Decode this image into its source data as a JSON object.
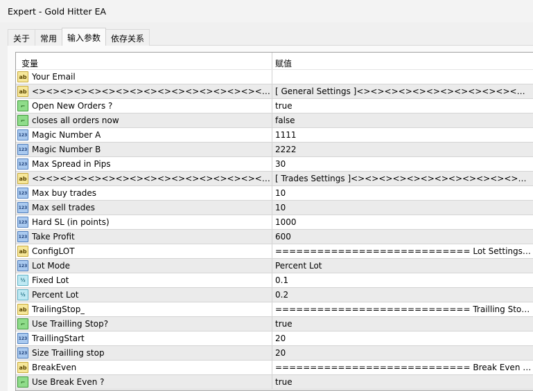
{
  "window": {
    "title": "Expert - Gold Hitter EA"
  },
  "tabs": [
    {
      "label": "关于"
    },
    {
      "label": "常用"
    },
    {
      "label": "输入参数",
      "active": true
    },
    {
      "label": "依存关系"
    }
  ],
  "table": {
    "headers": {
      "variable": "变量",
      "value": "赋值"
    },
    "rows": [
      {
        "type": "ab",
        "name": "Your Email",
        "value": ""
      },
      {
        "type": "ab",
        "name": "<><><><><><><><><><><><><><><><><><><><><><><><><><><><><><><>",
        "value": "[ General Settings ]<><><><><><><><><><><><><><><><><><><><><><><><>"
      },
      {
        "type": "bool",
        "name": "Open New Orders ?",
        "value": "true"
      },
      {
        "type": "bool",
        "name": "closes all orders now",
        "value": "false"
      },
      {
        "type": "int",
        "name": "Magic Number  A",
        "value": "1111"
      },
      {
        "type": "int",
        "name": "Magic Number  B",
        "value": "2222"
      },
      {
        "type": "int",
        "name": "Max Spread in Pips",
        "value": "30"
      },
      {
        "type": "ab",
        "name": "<><><><><><><><><><><><><><><><><><><><><><><><><><><><><><><>",
        "value": "[ Trades Settings ]<><><><><><><><><><><><><><><><><><><><><><><><>"
      },
      {
        "type": "int",
        "name": "Max buy trades",
        "value": "10"
      },
      {
        "type": "int",
        "name": "Max sell trades",
        "value": "10"
      },
      {
        "type": "int",
        "name": "Hard SL (in points)",
        "value": "1000"
      },
      {
        "type": "int",
        "name": "Take Profit",
        "value": "600"
      },
      {
        "type": "ab",
        "name": "ConfigLOT",
        "value": "============================ Lot Settings ============"
      },
      {
        "type": "int",
        "name": "Lot Mode",
        "value": "Percent Lot"
      },
      {
        "type": "dbl",
        "name": "Fixed Lot",
        "value": "0.1"
      },
      {
        "type": "dbl",
        "name": "Percent Lot",
        "value": "0.2"
      },
      {
        "type": "ab",
        "name": "TrailingStop_",
        "value": "============================ Trailling Stop Settings ====="
      },
      {
        "type": "bool",
        "name": "Use Trailling Stop?",
        "value": "true"
      },
      {
        "type": "int",
        "name": "TraillingStart",
        "value": "20"
      },
      {
        "type": "int",
        "name": "Size Trailling stop",
        "value": "20"
      },
      {
        "type": "ab",
        "name": "BreakEven",
        "value": "============================ Break Even Settings ====="
      },
      {
        "type": "bool",
        "name": "Use Break Even ?",
        "value": "true"
      }
    ]
  },
  "icons": {
    "ab": "ab",
    "bool": "⌐",
    "int": "123",
    "dbl": "½"
  }
}
